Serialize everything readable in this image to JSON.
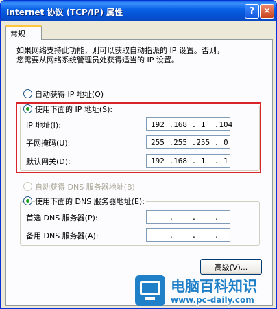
{
  "window": {
    "title": "Internet 协议 (TCP/IP) 属性",
    "help_label": "?",
    "close_label": "✕"
  },
  "tab": {
    "label": "常规"
  },
  "description": {
    "line1": "如果网络支持此功能，则可以获取自动指派的 IP 设置。否则，",
    "line2": "您需要从网络系统管理员处获得适当的 IP 设置。"
  },
  "ip": {
    "auto_label": "自动获得 IP 地址(O)",
    "manual_label": "使用下面的 IP 地址(S):",
    "selected": "manual",
    "address_label": "IP 地址(I):",
    "address_value": "192 .168 . 1  .104",
    "mask_label": "子网掩码(U):",
    "mask_value": "255 .255 .255 . 0",
    "gateway_label": "默认网关(D):",
    "gateway_value": "192 .168 . 1  . 1"
  },
  "dns": {
    "auto_label": "自动获得 DNS 服务器地址(B)",
    "manual_label": "使用下面的 DNS 服务器地址(E):",
    "preferred_label": "首选 DNS 服务器(P):",
    "preferred_value": "    .    .    .",
    "alternate_label": "备用 DNS 服务器(A):",
    "alternate_value": "    .    .    ."
  },
  "buttons": {
    "advanced_label": "高级(V)..."
  },
  "watermark": {
    "name": "电脑百科知识",
    "url": "www.pc-daily.com"
  },
  "colors": {
    "titlebar": "#0553d6",
    "highlight_border": "#d9252a",
    "tab_accent": "#ffc83c",
    "watermark": "#1f7fc7"
  }
}
